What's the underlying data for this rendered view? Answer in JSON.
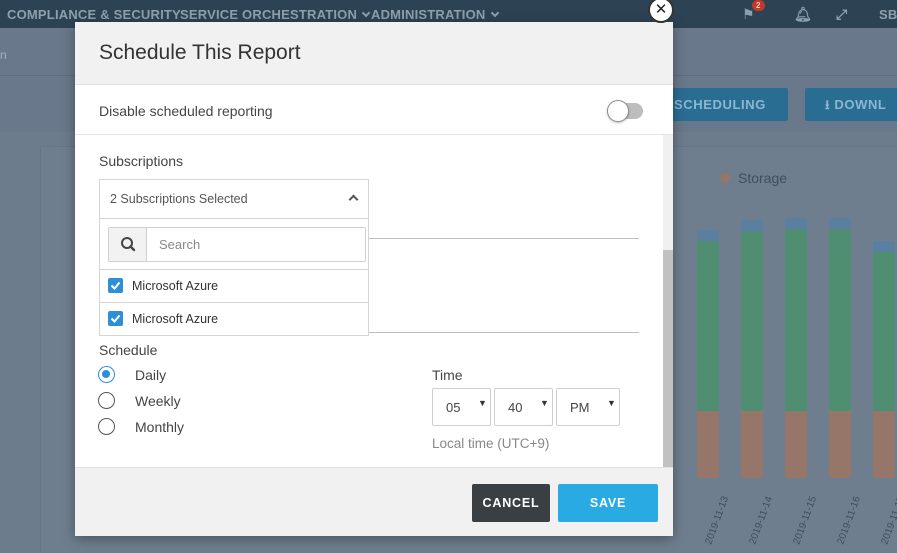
{
  "background": {
    "topnav": {
      "items": [
        "COMPLIANCE & SECURITY",
        "SERVICE ORCHESTRATION",
        "ADMINISTRATION"
      ],
      "notification_count": "2",
      "user_initials": "SBC"
    },
    "breadcrumb": "n",
    "actions": {
      "scheduling_label": "SCHEDULING",
      "download_label": "DOWNL"
    },
    "chart_data": {
      "type": "bar",
      "legend": [
        {
          "name": "Storage",
          "color": "#97766a"
        }
      ],
      "categories": [
        "2019-11-13",
        "2019-11-14",
        "2019-11-15",
        "2019-11-16",
        "2019-11-17"
      ],
      "colors": {
        "bottom": "#97766a",
        "middle": "#4f8e71",
        "top": "#5a7fa0"
      }
    }
  },
  "modal": {
    "title": "Schedule This Report",
    "close_icon": "close-icon",
    "disable_label": "Disable scheduled reporting",
    "disable_enabled": false,
    "subscriptions_label": "Subscriptions",
    "dropdown": {
      "header": "2 Subscriptions Selected",
      "search_placeholder": "Search",
      "options": [
        {
          "label": "Microsoft Azure",
          "checked": true
        },
        {
          "label": "Microsoft Azure",
          "checked": true
        }
      ]
    },
    "schedule_label": "Schedule",
    "schedule_options": [
      "Daily",
      "Weekly",
      "Monthly"
    ],
    "schedule_selected": "Daily",
    "time_label": "Time",
    "time": {
      "hour": "05",
      "minute": "40",
      "ampm": "PM"
    },
    "timezone_note": "Local time (UTC+9)",
    "cancel_label": "CANCEL",
    "save_label": "SAVE"
  }
}
